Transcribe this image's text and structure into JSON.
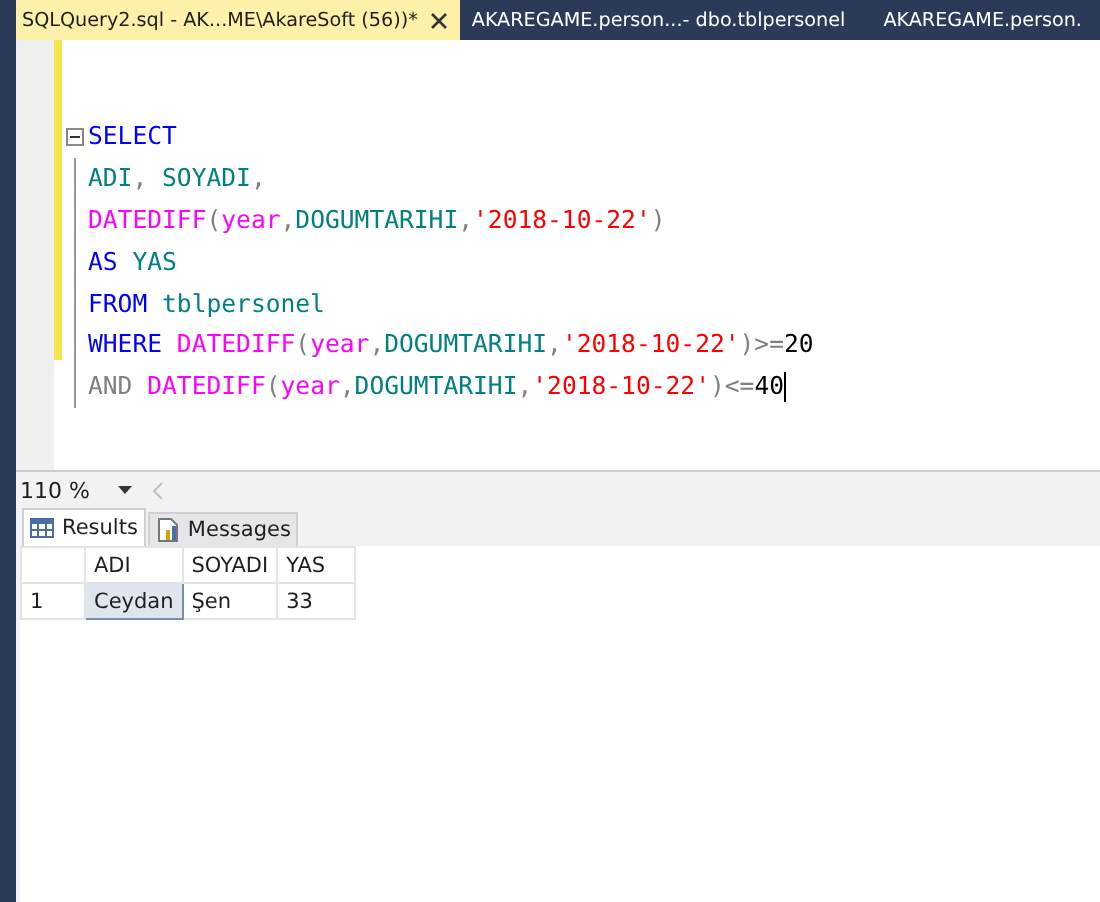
{
  "tabs": [
    {
      "label": "SQLQuery2.sql - AK...ME\\AkareSoft (56))*",
      "selected": true,
      "closable": true
    },
    {
      "label": "AKAREGAME.person...- dbo.tblpersonel",
      "selected": false,
      "closable": false
    },
    {
      "label": "AKAREGAME.person.",
      "selected": false,
      "closable": false
    }
  ],
  "editor": {
    "lines": [
      {
        "collapsible": true,
        "cursor": false,
        "tokens": [
          {
            "kind": "keyword",
            "text": "SELECT"
          }
        ]
      },
      {
        "collapsible": false,
        "cursor": false,
        "tokens": [
          {
            "kind": "identifier",
            "text": "ADI"
          },
          {
            "kind": "operator",
            "text": ", "
          },
          {
            "kind": "identifier",
            "text": "SOYADI"
          },
          {
            "kind": "operator",
            "text": ","
          }
        ]
      },
      {
        "collapsible": false,
        "cursor": false,
        "tokens": [
          {
            "kind": "function",
            "text": "DATEDIFF"
          },
          {
            "kind": "operator",
            "text": "("
          },
          {
            "kind": "function",
            "text": "year"
          },
          {
            "kind": "operator",
            "text": ","
          },
          {
            "kind": "identifier",
            "text": "DOGUMTARIHI"
          },
          {
            "kind": "operator",
            "text": ","
          },
          {
            "kind": "string",
            "text": "'2018-10-22'"
          },
          {
            "kind": "operator",
            "text": ")"
          }
        ]
      },
      {
        "collapsible": false,
        "cursor": false,
        "tokens": [
          {
            "kind": "keyword",
            "text": "AS"
          },
          {
            "kind": "identifier",
            "text": " YAS"
          }
        ]
      },
      {
        "collapsible": false,
        "cursor": false,
        "tokens": [
          {
            "kind": "keyword",
            "text": "FROM"
          },
          {
            "kind": "identifier",
            "text": " tblpersonel"
          }
        ]
      },
      {
        "collapsible": false,
        "cursor": false,
        "tokens": [
          {
            "kind": "keyword",
            "text": "WHERE "
          },
          {
            "kind": "function",
            "text": "DATEDIFF"
          },
          {
            "kind": "operator",
            "text": "("
          },
          {
            "kind": "function",
            "text": "year"
          },
          {
            "kind": "operator",
            "text": ","
          },
          {
            "kind": "identifier",
            "text": "DOGUMTARIHI"
          },
          {
            "kind": "operator",
            "text": ","
          },
          {
            "kind": "string",
            "text": "'2018-10-22'"
          },
          {
            "kind": "operator",
            "text": ")>="
          },
          {
            "kind": "number",
            "text": "20"
          }
        ]
      },
      {
        "collapsible": false,
        "cursor": true,
        "tokens": [
          {
            "kind": "operator",
            "text": "AND "
          },
          {
            "kind": "function",
            "text": "DATEDIFF"
          },
          {
            "kind": "operator",
            "text": "("
          },
          {
            "kind": "function",
            "text": "year"
          },
          {
            "kind": "operator",
            "text": ","
          },
          {
            "kind": "identifier",
            "text": "DOGUMTARIHI"
          },
          {
            "kind": "operator",
            "text": ","
          },
          {
            "kind": "string",
            "text": "'2018-10-22'"
          },
          {
            "kind": "operator",
            "text": ")<="
          },
          {
            "kind": "number",
            "text": "40"
          }
        ]
      }
    ]
  },
  "zoom": "110 %",
  "result_tabs": [
    {
      "label": "Results",
      "selected": true,
      "kind": "grid"
    },
    {
      "label": "Messages",
      "selected": false,
      "kind": "messages"
    }
  ],
  "grid": {
    "columns": [
      "ADI",
      "SOYADI",
      "YAS"
    ],
    "rows": [
      {
        "number": "1",
        "cells": [
          {
            "text": "Ceydan",
            "selected": true
          },
          {
            "text": "Şen",
            "selected": false
          },
          {
            "text": "33",
            "selected": false
          }
        ]
      }
    ]
  }
}
